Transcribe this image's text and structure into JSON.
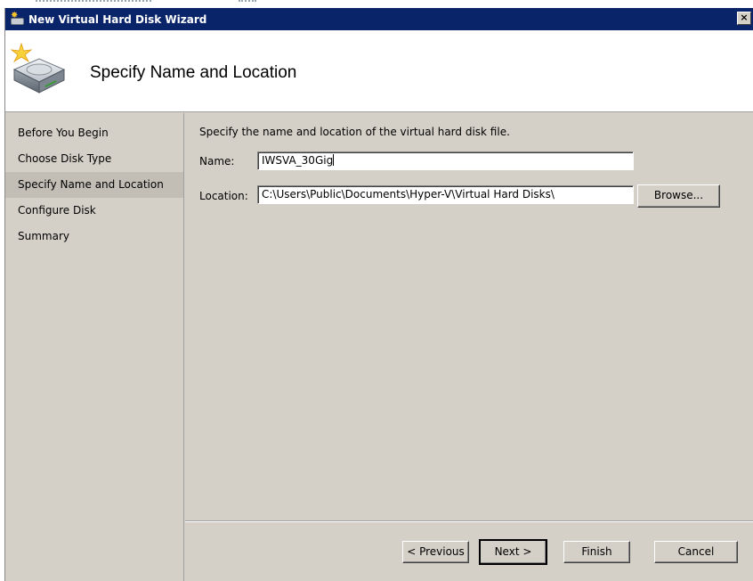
{
  "window": {
    "title": "New Virtual Hard Disk Wizard",
    "close_glyph": "×",
    "titlebar_color": "#0a246a"
  },
  "header": {
    "heading": "Specify Name and Location",
    "icon": "virtual-disk-wizard-icon"
  },
  "nav": {
    "items": [
      {
        "label": "Before You Begin",
        "active": false
      },
      {
        "label": "Choose Disk Type",
        "active": false
      },
      {
        "label": "Specify Name and Location",
        "active": true
      },
      {
        "label": "Configure Disk",
        "active": false
      },
      {
        "label": "Summary",
        "active": false
      }
    ]
  },
  "main": {
    "intro": "Specify the name and location of the virtual hard disk file.",
    "name_label": "Name:",
    "name_value": "IWSVA_30Gig",
    "location_label": "Location:",
    "location_value": "C:\\Users\\Public\\Documents\\Hyper-V\\Virtual Hard Disks\\",
    "browse_label": "Browse..."
  },
  "footer": {
    "previous_label": "< Previous",
    "next_label": "Next >",
    "finish_label": "Finish",
    "cancel_label": "Cancel"
  }
}
